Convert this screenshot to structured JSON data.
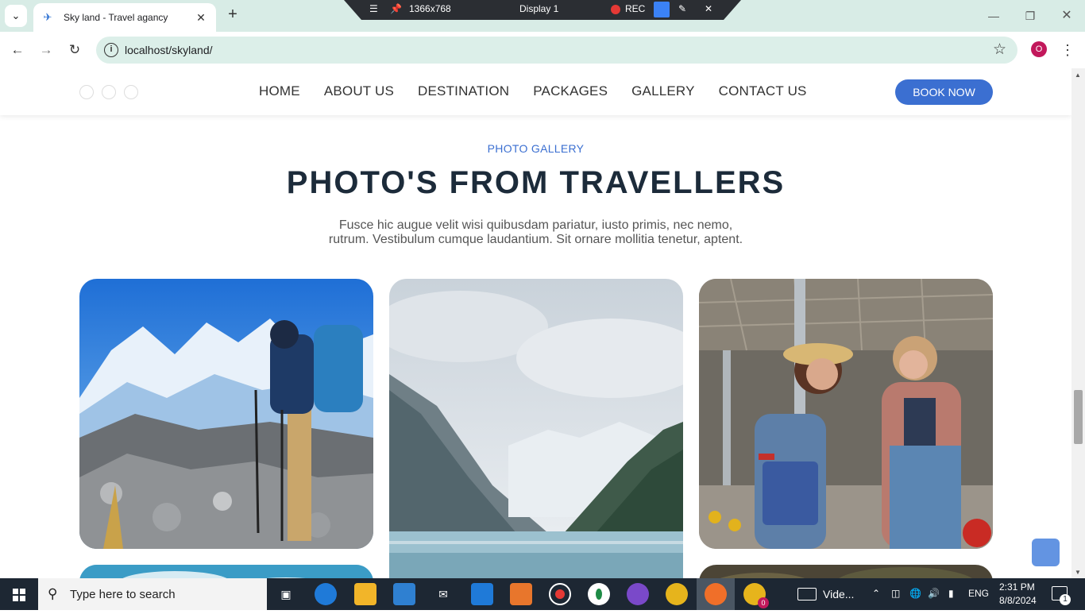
{
  "browser": {
    "tab_title": "Sky land - Travel agancy",
    "url": "localhost/skyland/",
    "profile_initial": "O"
  },
  "recorder": {
    "resolution": "1366x768",
    "display": "Display 1",
    "rec_label": "REC"
  },
  "site": {
    "nav": {
      "items": [
        "HOME",
        "ABOUT US",
        "DESTINATION",
        "PACKAGES",
        "GALLERY",
        "CONTACT US"
      ],
      "cta": "BOOK NOW"
    },
    "gallery": {
      "eyebrow": "PHOTO GALLERY",
      "title": "PHOTO'S FROM TRAVELLERS",
      "description_line1": "Fusce hic augue velit wisi quibusdam pariatur, iusto primis, nec nemo,",
      "description_line2": "rutrum. Vestibulum cumque laudantium. Sit ornare mollitia tenetur, aptent.",
      "photos": [
        {
          "subject": "hiker-mountains"
        },
        {
          "subject": "mountain-lake"
        },
        {
          "subject": "two-women-travellers"
        }
      ]
    },
    "accent_color": "#3b6fd1"
  },
  "taskbar": {
    "search_placeholder": "Type here to search",
    "active_app_label": "Vide...",
    "language": "ENG",
    "time": "2:31 PM",
    "date": "8/8/2024",
    "notification_count": "1",
    "chrome_badge": "0"
  }
}
